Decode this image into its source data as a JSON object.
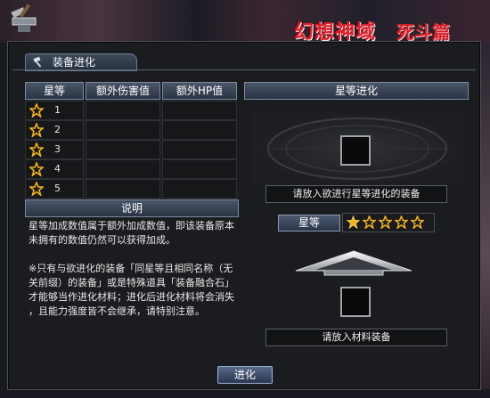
{
  "logo": {
    "main": "幻想神域",
    "sub": "死斗篇"
  },
  "panel": {
    "title": "装备进化"
  },
  "table": {
    "headers": [
      "星等",
      "额外伤害值",
      "额外HP值"
    ],
    "rows": [
      {
        "star": "1",
        "damage": "",
        "hp": ""
      },
      {
        "star": "2",
        "damage": "",
        "hp": ""
      },
      {
        "star": "3",
        "damage": "",
        "hp": ""
      },
      {
        "star": "4",
        "damage": "",
        "hp": ""
      },
      {
        "star": "5",
        "damage": "",
        "hp": ""
      }
    ]
  },
  "description": {
    "header": "说明",
    "text": "星等加成数值属于额外加成数值，即该装备原本\n未拥有的数值仍然可以获得加成。\n\n※只有与欲进化的装备「同星等且相同名称（无\n关前缀）的装备」或是特殊道具「装备融合石」\n才能够当作进化材料；进化后进化材料将会消失\n，且能力强度皆不会继承，请特别注意。"
  },
  "evolution": {
    "header": "星等进化",
    "equip_hint": "请放入欲进行星等进化的装备",
    "star_label": "星等",
    "star_count": 5,
    "stars_filled": 1,
    "material_hint": "请放入材料装备"
  },
  "actions": {
    "evolve": "进化"
  },
  "colors": {
    "star_fill": "#f2b21a",
    "button_bg": "#2a3448",
    "header_border": "#7a8aa0"
  }
}
